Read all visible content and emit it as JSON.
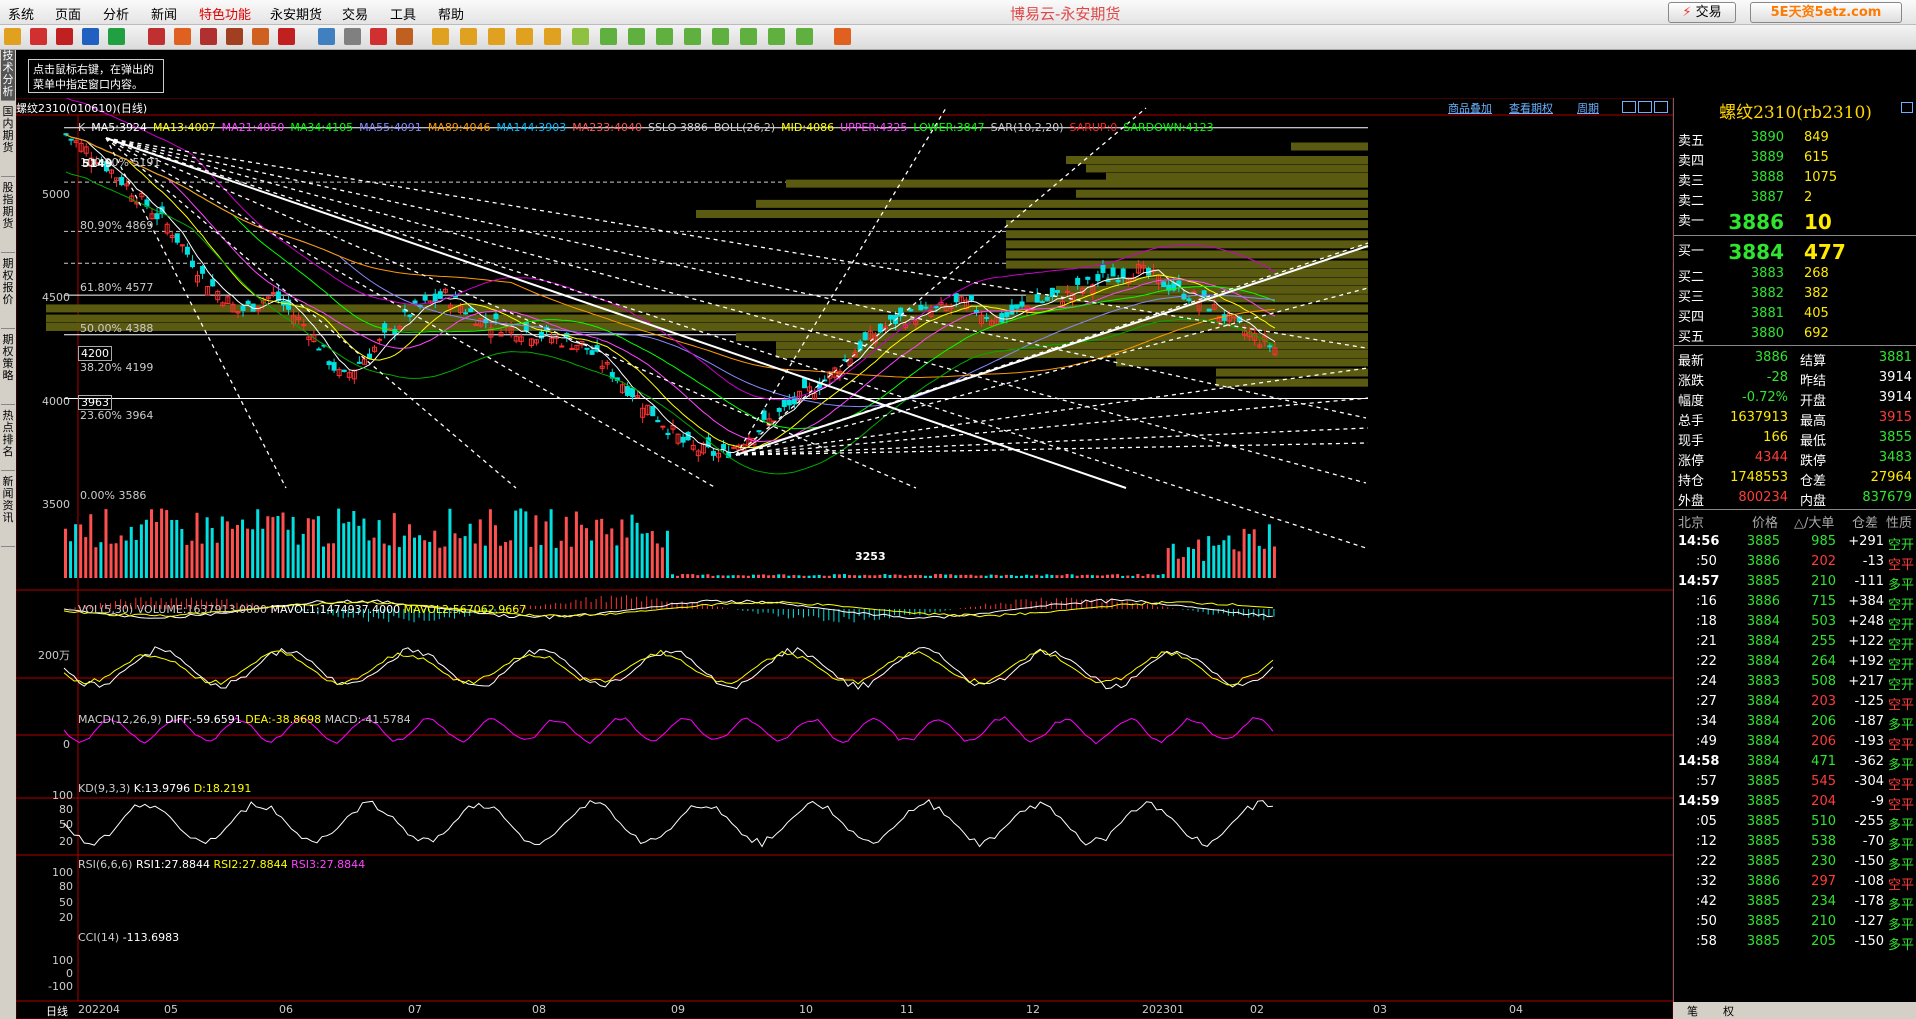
{
  "menu": [
    "系统",
    "页面",
    "分析",
    "新闻",
    "特色功能",
    "永安期货",
    "交易",
    "工具",
    "帮助"
  ],
  "menu_active_index": 4,
  "app_title": "博易云-永安期货",
  "trade_button": "交易",
  "watermark": "5E天资5etz.com",
  "hint": {
    "line1": "点击鼠标右键，在弹出的",
    "line2": "菜单中指定窗口内容。"
  },
  "left_tabs": [
    "技术分析",
    "国内期货",
    "股指期货",
    "期权报价",
    "期权策略",
    "热点排名",
    "新闻资讯"
  ],
  "chart": {
    "symbol_label": "螺纹2310(010610)(日线)",
    "links": {
      "overlay": "商品叠加",
      "options": "查看期权",
      "period": "周期"
    },
    "ma_line": [
      {
        "text": "K",
        "color": "#cccccc"
      },
      {
        "text": "MA5:3924",
        "color": "#ffffff"
      },
      {
        "text": "MA13:4007",
        "color": "#ffff00"
      },
      {
        "text": "MA21:4050",
        "color": "#ff44ff"
      },
      {
        "text": "MA34:4105",
        "color": "#00ff00"
      },
      {
        "text": "MA55:4091",
        "color": "#8888ff"
      },
      {
        "text": "MA89:4046",
        "color": "#ff9900"
      },
      {
        "text": "MA144:3903",
        "color": "#00bbff"
      },
      {
        "text": "MA233:4040",
        "color": "#ff5555"
      },
      {
        "text": "SSLO 3886",
        "color": "#cccccc"
      },
      {
        "text": "BOLL(26,2)",
        "color": "#cccccc"
      },
      {
        "text": "MID:4086",
        "color": "#ffff00"
      },
      {
        "text": "UPPER:4325",
        "color": "#ff44ff"
      },
      {
        "text": "LOWER:3847",
        "color": "#00ff00"
      },
      {
        "text": "SAR(10,2,20)",
        "color": "#cccccc"
      },
      {
        "text": "SARUP:0",
        "color": "#ff2222"
      },
      {
        "text": "SARDOWN:4123",
        "color": "#00ff00"
      }
    ],
    "price_axis": [
      "5000",
      "4500",
      "4000",
      "3500"
    ],
    "fib_labels": [
      "100.00% 5191",
      "80.90% 4869",
      "61.80% 4577",
      "50.00% 4388",
      "38.20% 4199",
      "23.60% 3964",
      "0.00% 3586"
    ],
    "boxed_prices": [
      "4200",
      "3963"
    ],
    "high_label": "5149",
    "low_label": "3253",
    "vol_title": "VOL(5,30)",
    "vol_values": "VOLUME:1637913.0000",
    "mavol1": "MAVOL1:1474937.4000",
    "mavol2": "MAVOL2:567062.9667",
    "vol_axis": "200万",
    "macd_title": "MACD(12,26,9)",
    "macd_diff": "DIFF:-59.6591",
    "macd_dea": "DEA:-38.8698",
    "macd_val": "MACD:-41.5784",
    "macd_axis": "0",
    "kd_title": "KD(9,3,3)",
    "kd_k": "K:13.9796",
    "kd_d": "D:18.2191",
    "kd_axis": [
      "100",
      "80",
      "50",
      "20"
    ],
    "rsi_title": "RSI(6,6,6)",
    "rsi1": "RSI1:27.8844",
    "rsi2": "RSI2:27.8844",
    "rsi3": "RSI3:27.8844",
    "rsi_axis": [
      "100",
      "80",
      "50",
      "20"
    ],
    "cci_title": "CCI(14)",
    "cci_val": "-113.6983",
    "cci_axis": [
      "100",
      "0",
      "-100"
    ],
    "period_label": "日线",
    "dates": [
      "202204",
      "05",
      "06",
      "07",
      "08",
      "09",
      "10",
      "11",
      "12",
      "202301",
      "02",
      "03",
      "04"
    ]
  },
  "quote": {
    "title": "螺纹2310(rb2310)",
    "asks": [
      {
        "label": "卖五",
        "price": "3890",
        "vol": "849"
      },
      {
        "label": "卖四",
        "price": "3889",
        "vol": "615"
      },
      {
        "label": "卖三",
        "price": "3888",
        "vol": "1075"
      },
      {
        "label": "卖二",
        "price": "3887",
        "vol": "2"
      },
      {
        "label": "卖一",
        "price": "3886",
        "vol": "10"
      }
    ],
    "bids": [
      {
        "label": "买一",
        "price": "3884",
        "vol": "477"
      },
      {
        "label": "买二",
        "price": "3883",
        "vol": "268"
      },
      {
        "label": "买三",
        "price": "3882",
        "vol": "382"
      },
      {
        "label": "买四",
        "price": "3881",
        "vol": "405"
      },
      {
        "label": "买五",
        "price": "3880",
        "vol": "692"
      }
    ],
    "stats": [
      {
        "l1": "最新",
        "v1": "3886",
        "c1": "green",
        "l2": "结算",
        "v2": "3881",
        "c2": "green"
      },
      {
        "l1": "涨跌",
        "v1": "-28",
        "c1": "green",
        "l2": "昨结",
        "v2": "3914",
        "c2": "white"
      },
      {
        "l1": "幅度",
        "v1": "-0.72%",
        "c1": "green",
        "l2": "开盘",
        "v2": "3914",
        "c2": "white"
      },
      {
        "l1": "总手",
        "v1": "1637913",
        "c1": "yellow",
        "l2": "最高",
        "v2": "3915",
        "c2": "red"
      },
      {
        "l1": "现手",
        "v1": "166",
        "c1": "yellow",
        "l2": "最低",
        "v2": "3855",
        "c2": "green"
      },
      {
        "l1": "涨停",
        "v1": "4344",
        "c1": "red",
        "l2": "跌停",
        "v2": "3483",
        "c2": "green"
      },
      {
        "l1": "持仓",
        "v1": "1748553",
        "c1": "yellow",
        "l2": "仓差",
        "v2": "27964",
        "c2": "yellow"
      },
      {
        "l1": "外盘",
        "v1": "800234",
        "c1": "red",
        "l2": "内盘",
        "v2": "837679",
        "c2": "green"
      }
    ],
    "ticks_header": {
      "time": "北京",
      "price": "价格",
      "vol": "△/大单",
      "diff": "仓差",
      "nature": "性质"
    },
    "ticks": [
      {
        "t": "14:56",
        "p": "3885",
        "v": "985",
        "vc": "green",
        "d": "+291",
        "n": "空开",
        "nc": "green",
        "bold": true
      },
      {
        "t": ":50",
        "p": "3886",
        "v": "202",
        "vc": "red",
        "d": "-13",
        "n": "空平",
        "nc": "red",
        "bold": false
      },
      {
        "t": "14:57",
        "p": "3885",
        "v": "210",
        "vc": "green",
        "d": "-111",
        "n": "多平",
        "nc": "green",
        "bold": true
      },
      {
        "t": ":16",
        "p": "3886",
        "v": "715",
        "vc": "green",
        "d": "+384",
        "n": "空开",
        "nc": "green",
        "bold": false
      },
      {
        "t": ":18",
        "p": "3884",
        "v": "503",
        "vc": "green",
        "d": "+248",
        "n": "空开",
        "nc": "green",
        "bold": false
      },
      {
        "t": ":21",
        "p": "3884",
        "v": "255",
        "vc": "green",
        "d": "+122",
        "n": "空开",
        "nc": "green",
        "bold": false
      },
      {
        "t": ":22",
        "p": "3884",
        "v": "264",
        "vc": "green",
        "d": "+192",
        "n": "空开",
        "nc": "green",
        "bold": false
      },
      {
        "t": ":24",
        "p": "3883",
        "v": "508",
        "vc": "green",
        "d": "+217",
        "n": "空开",
        "nc": "green",
        "bold": false
      },
      {
        "t": ":27",
        "p": "3884",
        "v": "203",
        "vc": "red",
        "d": "-125",
        "n": "空平",
        "nc": "red",
        "bold": false
      },
      {
        "t": ":34",
        "p": "3884",
        "v": "206",
        "vc": "green",
        "d": "-187",
        "n": "多平",
        "nc": "green",
        "bold": false
      },
      {
        "t": ":49",
        "p": "3884",
        "v": "206",
        "vc": "red",
        "d": "-193",
        "n": "空平",
        "nc": "red",
        "bold": false
      },
      {
        "t": "14:58",
        "p": "3884",
        "v": "471",
        "vc": "green",
        "d": "-362",
        "n": "多平",
        "nc": "green",
        "bold": true
      },
      {
        "t": ":57",
        "p": "3885",
        "v": "545",
        "vc": "red",
        "d": "-304",
        "n": "空平",
        "nc": "red",
        "bold": false
      },
      {
        "t": "14:59",
        "p": "3885",
        "v": "204",
        "vc": "red",
        "d": "-9",
        "n": "空平",
        "nc": "red",
        "bold": true
      },
      {
        "t": ":05",
        "p": "3885",
        "v": "510",
        "vc": "green",
        "d": "-255",
        "n": "多平",
        "nc": "green",
        "bold": false
      },
      {
        "t": ":12",
        "p": "3885",
        "v": "538",
        "vc": "green",
        "d": "-70",
        "n": "多平",
        "nc": "green",
        "bold": false
      },
      {
        "t": ":22",
        "p": "3885",
        "v": "230",
        "vc": "green",
        "d": "-150",
        "n": "多平",
        "nc": "green",
        "bold": false
      },
      {
        "t": ":32",
        "p": "3886",
        "v": "297",
        "vc": "red",
        "d": "-108",
        "n": "空平",
        "nc": "red",
        "bold": false
      },
      {
        "t": ":42",
        "p": "3885",
        "v": "234",
        "vc": "green",
        "d": "-178",
        "n": "多平",
        "nc": "green",
        "bold": false
      },
      {
        "t": ":50",
        "p": "3885",
        "v": "210",
        "vc": "green",
        "d": "-127",
        "n": "多平",
        "nc": "green",
        "bold": false
      },
      {
        "t": ":58",
        "p": "3885",
        "v": "205",
        "vc": "green",
        "d": "-150",
        "n": "多平",
        "nc": "green",
        "bold": false
      }
    ],
    "bottom_tabs": [
      "笔",
      "权"
    ]
  }
}
